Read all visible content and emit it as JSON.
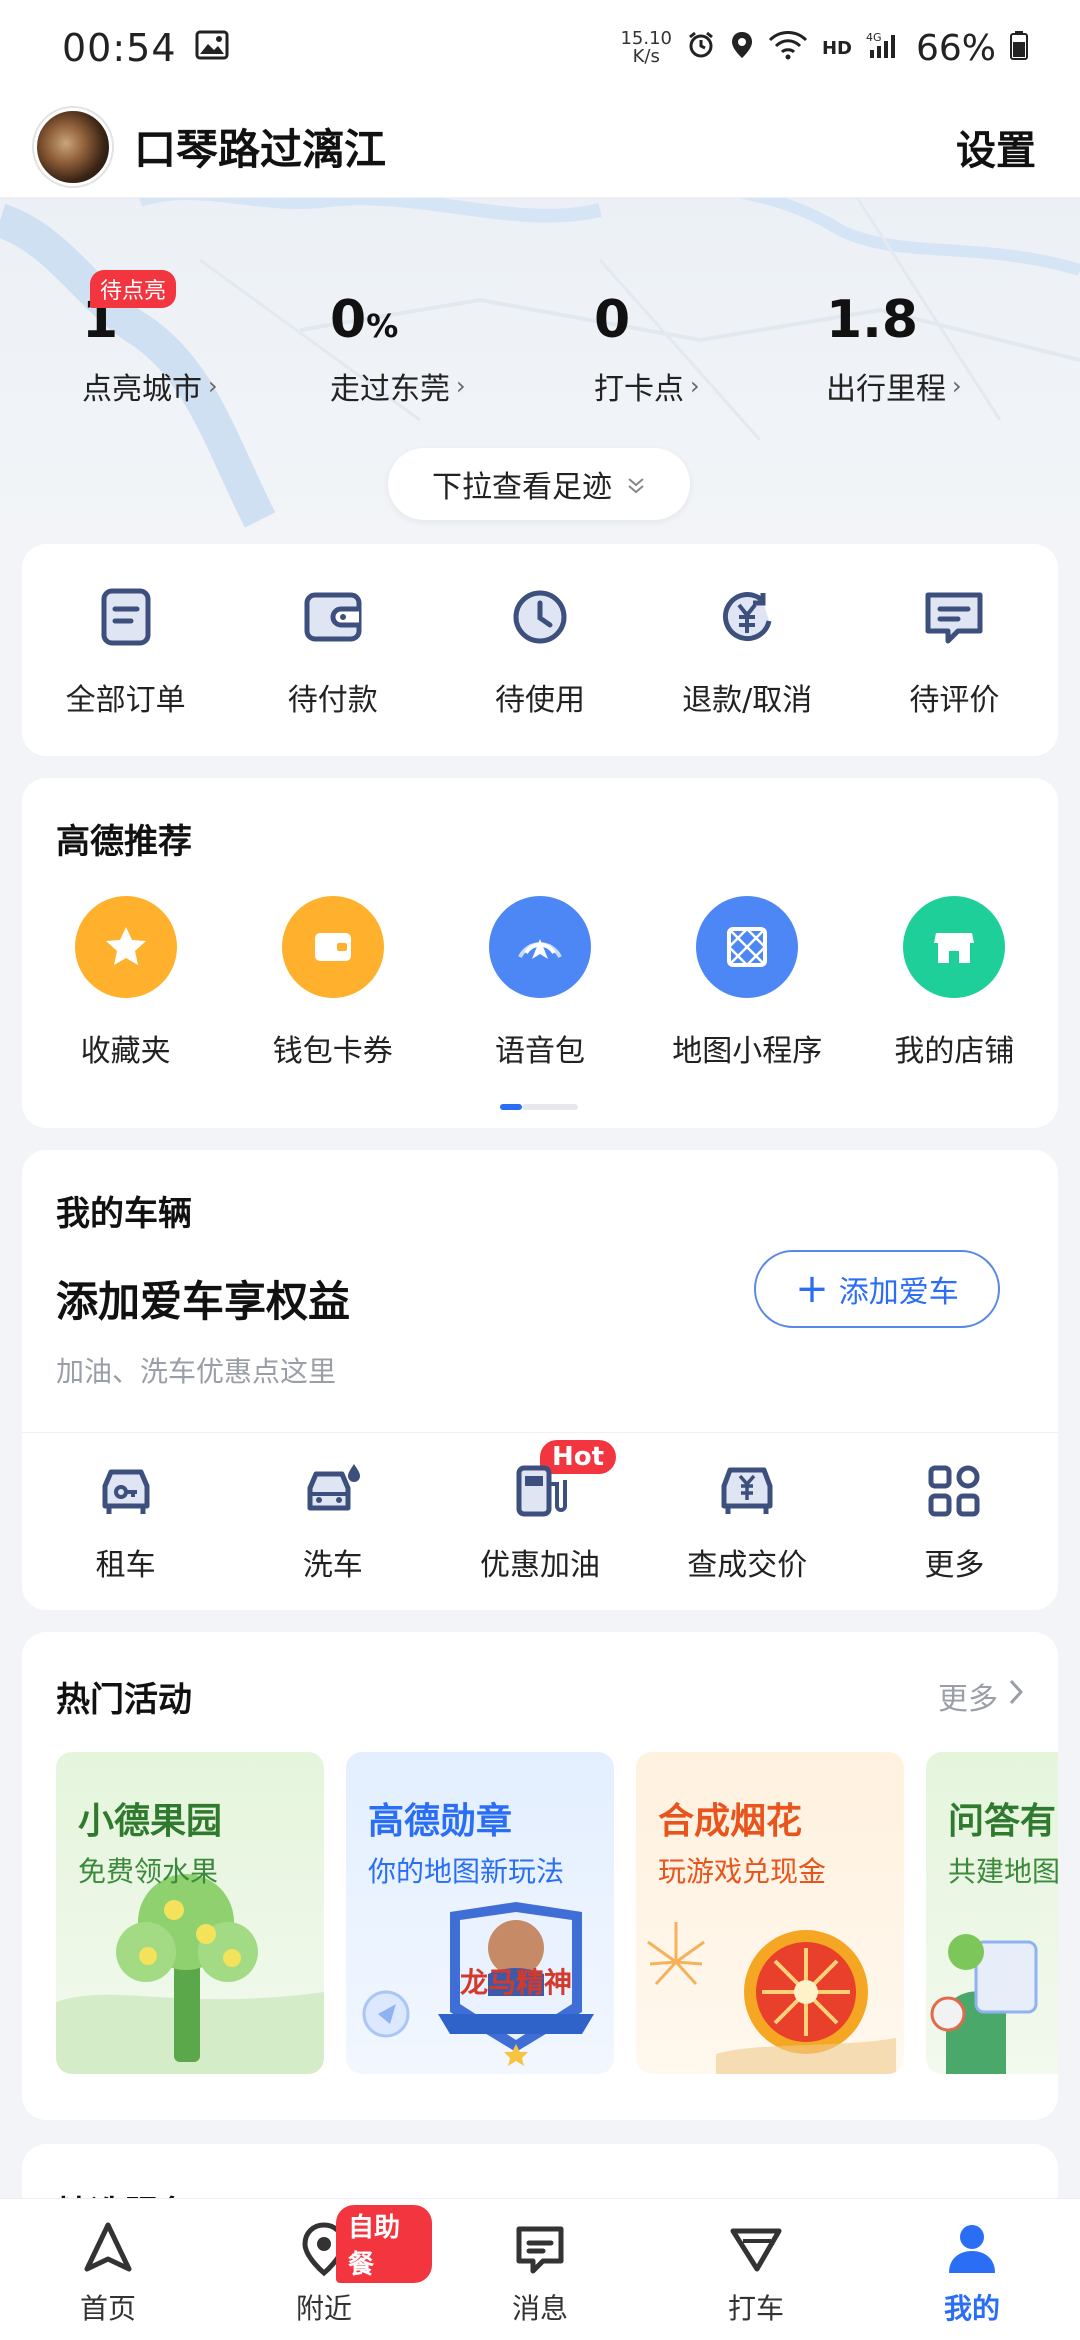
{
  "status_bar": {
    "time": "00:54",
    "net_speed_value": "15.10",
    "net_speed_unit": "K/s",
    "battery": "66%"
  },
  "header": {
    "username": "口琴路过漓江",
    "settings_label": "设置"
  },
  "stats": {
    "badge": "待点亮",
    "items": [
      {
        "value": "1",
        "unit": "",
        "label": "点亮城市"
      },
      {
        "value": "0",
        "unit": "%",
        "label": "走过东莞"
      },
      {
        "value": "0",
        "unit": "",
        "label": "打卡点"
      },
      {
        "value": "1.8",
        "unit": "",
        "label": "出行里程"
      }
    ],
    "pull_hint": "下拉查看足迹"
  },
  "orders": {
    "items": [
      {
        "label": "全部订单",
        "icon": "order-list-icon"
      },
      {
        "label": "待付款",
        "icon": "wallet-icon"
      },
      {
        "label": "待使用",
        "icon": "clock-icon"
      },
      {
        "label": "退款/取消",
        "icon": "refund-icon"
      },
      {
        "label": "待评价",
        "icon": "comment-icon"
      }
    ]
  },
  "recommend": {
    "title": "高德推荐",
    "items": [
      {
        "label": "收藏夹",
        "icon": "star-icon",
        "color": "#ffb12e"
      },
      {
        "label": "钱包卡券",
        "icon": "wallet-card-icon",
        "color": "#ffb12e"
      },
      {
        "label": "语音包",
        "icon": "voice-pack-icon",
        "color": "#4d86f5"
      },
      {
        "label": "地图小程序",
        "icon": "mini-program-icon",
        "color": "#4d86f5"
      },
      {
        "label": "我的店铺",
        "icon": "store-icon",
        "color": "#1fcf9a"
      }
    ]
  },
  "vehicle": {
    "title": "我的车辆",
    "headline": "添加爱车享权益",
    "subtitle": "加油、洗车优惠点这里",
    "add_button": "添加爱车",
    "hot_badge": "Hot",
    "items": [
      {
        "label": "租车",
        "icon": "rental-car-icon"
      },
      {
        "label": "洗车",
        "icon": "car-wash-icon"
      },
      {
        "label": "优惠加油",
        "icon": "fuel-icon"
      },
      {
        "label": "查成交价",
        "icon": "price-car-icon"
      },
      {
        "label": "更多",
        "icon": "grid-more-icon"
      }
    ]
  },
  "activities": {
    "title": "热门活动",
    "more_label": "更多",
    "items": [
      {
        "title": "小德果园",
        "subtitle": "免费领水果",
        "title_color": "#2f7a2f",
        "sub_color": "#3c8a3c"
      },
      {
        "title": "高德勋章",
        "subtitle": "你的地图新玩法",
        "title_color": "#2b6ef6",
        "sub_color": "#2b6ef6"
      },
      {
        "title": "合成烟花",
        "subtitle": "玩游戏兑现金",
        "title_color": "#e8541b",
        "sub_color": "#e8541b"
      },
      {
        "title": "问答有",
        "subtitle": "共建地图",
        "title_color": "#2f7a2f",
        "sub_color": "#3c8a3c"
      }
    ],
    "medal_text": "龙马精神"
  },
  "featured": {
    "title": "精选服务"
  },
  "bottom_nav": {
    "badge": "自助餐",
    "tabs": [
      {
        "label": "首页",
        "icon": "home-arrow-icon"
      },
      {
        "label": "附近",
        "icon": "nearby-pin-icon"
      },
      {
        "label": "消息",
        "icon": "message-icon"
      },
      {
        "label": "打车",
        "icon": "taxi-icon"
      },
      {
        "label": "我的",
        "icon": "profile-icon",
        "active": true
      }
    ]
  },
  "colors": {
    "accent": "#2b6ef6",
    "badge_red": "#f2353f",
    "icon_navy": "#3d4f7c"
  }
}
